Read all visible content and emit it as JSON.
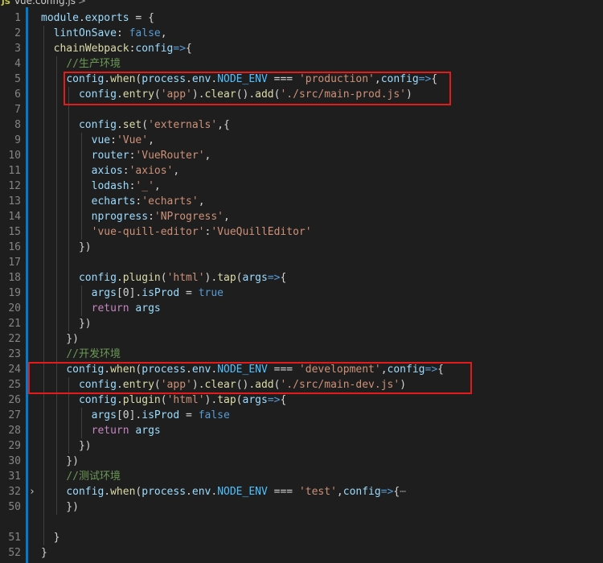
{
  "tab": {
    "icon_label": "JS",
    "filename": "vue.config.js",
    "breadcrumb_chevron": ">"
  },
  "lines": [
    {
      "n": "1",
      "seg": [
        [
          "k-var",
          "module"
        ],
        [
          "k-op",
          "."
        ],
        [
          "k-var",
          "exports"
        ],
        [
          "k-op",
          " = {"
        ]
      ]
    },
    {
      "n": "2",
      "seg": [
        [
          "k-op",
          "  "
        ],
        [
          "k-var",
          "lintOnSave"
        ],
        [
          "k-op",
          ": "
        ],
        [
          "k-bool",
          "false"
        ],
        [
          "k-op",
          ","
        ]
      ]
    },
    {
      "n": "3",
      "seg": [
        [
          "k-op",
          "  "
        ],
        [
          "k-fn",
          "chainWebpack"
        ],
        [
          "k-op",
          ":"
        ],
        [
          "k-var",
          "config"
        ],
        [
          "k-arrow",
          "=>"
        ],
        [
          "k-op",
          "{"
        ]
      ]
    },
    {
      "n": "4",
      "seg": [
        [
          "k-op",
          "    "
        ],
        [
          "k-cmt",
          "//生产环境"
        ]
      ]
    },
    {
      "n": "5",
      "seg": [
        [
          "k-op",
          "    "
        ],
        [
          "k-var",
          "config"
        ],
        [
          "k-op",
          "."
        ],
        [
          "k-fn",
          "when"
        ],
        [
          "k-op",
          "("
        ],
        [
          "k-var",
          "process"
        ],
        [
          "k-op",
          "."
        ],
        [
          "k-var",
          "env"
        ],
        [
          "k-op",
          "."
        ],
        [
          "k-prop",
          "NODE_ENV"
        ],
        [
          "k-op",
          " === "
        ],
        [
          "k-str",
          "'production'"
        ],
        [
          "k-op",
          ","
        ],
        [
          "k-var",
          "config"
        ],
        [
          "k-arrow",
          "=>"
        ],
        [
          "k-op",
          "{"
        ]
      ]
    },
    {
      "n": "6",
      "seg": [
        [
          "k-op",
          "      "
        ],
        [
          "k-var",
          "config"
        ],
        [
          "k-op",
          "."
        ],
        [
          "k-fn",
          "entry"
        ],
        [
          "k-op",
          "("
        ],
        [
          "k-str",
          "'app'"
        ],
        [
          "k-op",
          ")."
        ],
        [
          "k-fn",
          "clear"
        ],
        [
          "k-op",
          "()."
        ],
        [
          "k-fn",
          "add"
        ],
        [
          "k-op",
          "("
        ],
        [
          "k-str",
          "'./src/main-prod.js'"
        ],
        [
          "k-op",
          ")"
        ]
      ]
    },
    {
      "n": "7",
      "seg": []
    },
    {
      "n": "8",
      "seg": [
        [
          "k-op",
          "      "
        ],
        [
          "k-var",
          "config"
        ],
        [
          "k-op",
          "."
        ],
        [
          "k-fn",
          "set"
        ],
        [
          "k-op",
          "("
        ],
        [
          "k-str",
          "'externals'"
        ],
        [
          "k-op",
          ",{"
        ]
      ]
    },
    {
      "n": "9",
      "seg": [
        [
          "k-op",
          "        "
        ],
        [
          "k-var",
          "vue"
        ],
        [
          "k-op",
          ":"
        ],
        [
          "k-str",
          "'Vue'"
        ],
        [
          "k-op",
          ","
        ]
      ]
    },
    {
      "n": "10",
      "seg": [
        [
          "k-op",
          "        "
        ],
        [
          "k-var",
          "router"
        ],
        [
          "k-op",
          ":"
        ],
        [
          "k-str",
          "'VueRouter'"
        ],
        [
          "k-op",
          ","
        ]
      ]
    },
    {
      "n": "11",
      "seg": [
        [
          "k-op",
          "        "
        ],
        [
          "k-var",
          "axios"
        ],
        [
          "k-op",
          ":"
        ],
        [
          "k-str",
          "'axios'"
        ],
        [
          "k-op",
          ","
        ]
      ]
    },
    {
      "n": "12",
      "seg": [
        [
          "k-op",
          "        "
        ],
        [
          "k-var",
          "lodash"
        ],
        [
          "k-op",
          ":"
        ],
        [
          "k-str",
          "'_'"
        ],
        [
          "k-op",
          ","
        ]
      ]
    },
    {
      "n": "13",
      "seg": [
        [
          "k-op",
          "        "
        ],
        [
          "k-var",
          "echarts"
        ],
        [
          "k-op",
          ":"
        ],
        [
          "k-str",
          "'echarts'"
        ],
        [
          "k-op",
          ","
        ]
      ]
    },
    {
      "n": "14",
      "seg": [
        [
          "k-op",
          "        "
        ],
        [
          "k-var",
          "nprogress"
        ],
        [
          "k-op",
          ":"
        ],
        [
          "k-str",
          "'NProgress'"
        ],
        [
          "k-op",
          ","
        ]
      ]
    },
    {
      "n": "15",
      "seg": [
        [
          "k-op",
          "        "
        ],
        [
          "k-str",
          "'vue-quill-editor'"
        ],
        [
          "k-op",
          ":"
        ],
        [
          "k-str",
          "'VueQuillEditor'"
        ]
      ]
    },
    {
      "n": "16",
      "seg": [
        [
          "k-op",
          "      })"
        ]
      ]
    },
    {
      "n": "17",
      "seg": []
    },
    {
      "n": "18",
      "seg": [
        [
          "k-op",
          "      "
        ],
        [
          "k-var",
          "config"
        ],
        [
          "k-op",
          "."
        ],
        [
          "k-fn",
          "plugin"
        ],
        [
          "k-op",
          "("
        ],
        [
          "k-str",
          "'html'"
        ],
        [
          "k-op",
          ")."
        ],
        [
          "k-fn",
          "tap"
        ],
        [
          "k-op",
          "("
        ],
        [
          "k-var",
          "args"
        ],
        [
          "k-arrow",
          "=>"
        ],
        [
          "k-op",
          "{"
        ]
      ]
    },
    {
      "n": "19",
      "seg": [
        [
          "k-op",
          "        "
        ],
        [
          "k-var",
          "args"
        ],
        [
          "k-op",
          "[0]."
        ],
        [
          "k-var",
          "isProd"
        ],
        [
          "k-op",
          " = "
        ],
        [
          "k-bool",
          "true"
        ]
      ]
    },
    {
      "n": "20",
      "seg": [
        [
          "k-op",
          "        "
        ],
        [
          "k-kw",
          "return"
        ],
        [
          "k-op",
          " "
        ],
        [
          "k-var",
          "args"
        ]
      ]
    },
    {
      "n": "21",
      "seg": [
        [
          "k-op",
          "      })"
        ]
      ]
    },
    {
      "n": "22",
      "seg": [
        [
          "k-op",
          "    })"
        ]
      ]
    },
    {
      "n": "23",
      "seg": [
        [
          "k-op",
          "    "
        ],
        [
          "k-cmt",
          "//开发环境"
        ]
      ]
    },
    {
      "n": "24",
      "seg": [
        [
          "k-op",
          "    "
        ],
        [
          "k-var",
          "config"
        ],
        [
          "k-op",
          "."
        ],
        [
          "k-fn",
          "when"
        ],
        [
          "k-op",
          "("
        ],
        [
          "k-var",
          "process"
        ],
        [
          "k-op",
          "."
        ],
        [
          "k-var",
          "env"
        ],
        [
          "k-op",
          "."
        ],
        [
          "k-prop",
          "NODE_ENV"
        ],
        [
          "k-op",
          " === "
        ],
        [
          "k-str",
          "'development'"
        ],
        [
          "k-op",
          ","
        ],
        [
          "k-var",
          "config"
        ],
        [
          "k-arrow",
          "=>"
        ],
        [
          "k-op",
          "{"
        ]
      ]
    },
    {
      "n": "25",
      "seg": [
        [
          "k-op",
          "      "
        ],
        [
          "k-var",
          "config"
        ],
        [
          "k-op",
          "."
        ],
        [
          "k-fn",
          "entry"
        ],
        [
          "k-op",
          "("
        ],
        [
          "k-str",
          "'app'"
        ],
        [
          "k-op",
          ")."
        ],
        [
          "k-fn",
          "clear"
        ],
        [
          "k-op",
          "()."
        ],
        [
          "k-fn",
          "add"
        ],
        [
          "k-op",
          "("
        ],
        [
          "k-str",
          "'./src/main-dev.js'"
        ],
        [
          "k-op",
          ")"
        ]
      ]
    },
    {
      "n": "26",
      "seg": [
        [
          "k-op",
          "      "
        ],
        [
          "k-var",
          "config"
        ],
        [
          "k-op",
          "."
        ],
        [
          "k-fn",
          "plugin"
        ],
        [
          "k-op",
          "("
        ],
        [
          "k-str",
          "'html'"
        ],
        [
          "k-op",
          ")."
        ],
        [
          "k-fn",
          "tap"
        ],
        [
          "k-op",
          "("
        ],
        [
          "k-var",
          "args"
        ],
        [
          "k-arrow",
          "=>"
        ],
        [
          "k-op",
          "{"
        ]
      ]
    },
    {
      "n": "27",
      "seg": [
        [
          "k-op",
          "        "
        ],
        [
          "k-var",
          "args"
        ],
        [
          "k-op",
          "[0]."
        ],
        [
          "k-var",
          "isProd"
        ],
        [
          "k-op",
          " = "
        ],
        [
          "k-bool",
          "false"
        ]
      ]
    },
    {
      "n": "28",
      "seg": [
        [
          "k-op",
          "        "
        ],
        [
          "k-kw",
          "return"
        ],
        [
          "k-op",
          " "
        ],
        [
          "k-var",
          "args"
        ]
      ]
    },
    {
      "n": "29",
      "seg": [
        [
          "k-op",
          "      })"
        ]
      ]
    },
    {
      "n": "30",
      "seg": [
        [
          "k-op",
          "    })"
        ]
      ]
    },
    {
      "n": "31",
      "seg": [
        [
          "k-op",
          "    "
        ],
        [
          "k-cmt",
          "//测试环境"
        ]
      ]
    },
    {
      "n": "32",
      "fold": true,
      "seg": [
        [
          "k-op",
          "    "
        ],
        [
          "k-var",
          "config"
        ],
        [
          "k-op",
          "."
        ],
        [
          "k-fn",
          "when"
        ],
        [
          "k-op",
          "("
        ],
        [
          "k-var",
          "process"
        ],
        [
          "k-op",
          "."
        ],
        [
          "k-var",
          "env"
        ],
        [
          "k-op",
          "."
        ],
        [
          "k-prop",
          "NODE_ENV"
        ],
        [
          "k-op",
          " === "
        ],
        [
          "k-str",
          "'test'"
        ],
        [
          "k-op",
          ","
        ],
        [
          "k-var",
          "config"
        ],
        [
          "k-arrow",
          "=>"
        ],
        [
          "k-op",
          "{"
        ],
        [
          "k-ellipsis",
          "⋯"
        ]
      ]
    },
    {
      "n": "50",
      "seg": [
        [
          "k-op",
          "    })"
        ]
      ]
    },
    {
      "n": "",
      "seg": []
    },
    {
      "n": "51",
      "seg": [
        [
          "k-op",
          "  }"
        ]
      ]
    },
    {
      "n": "52",
      "seg": [
        [
          "k-op",
          "}"
        ]
      ]
    }
  ],
  "fold_glyph": "›",
  "highlight_color": "#e51a1a"
}
